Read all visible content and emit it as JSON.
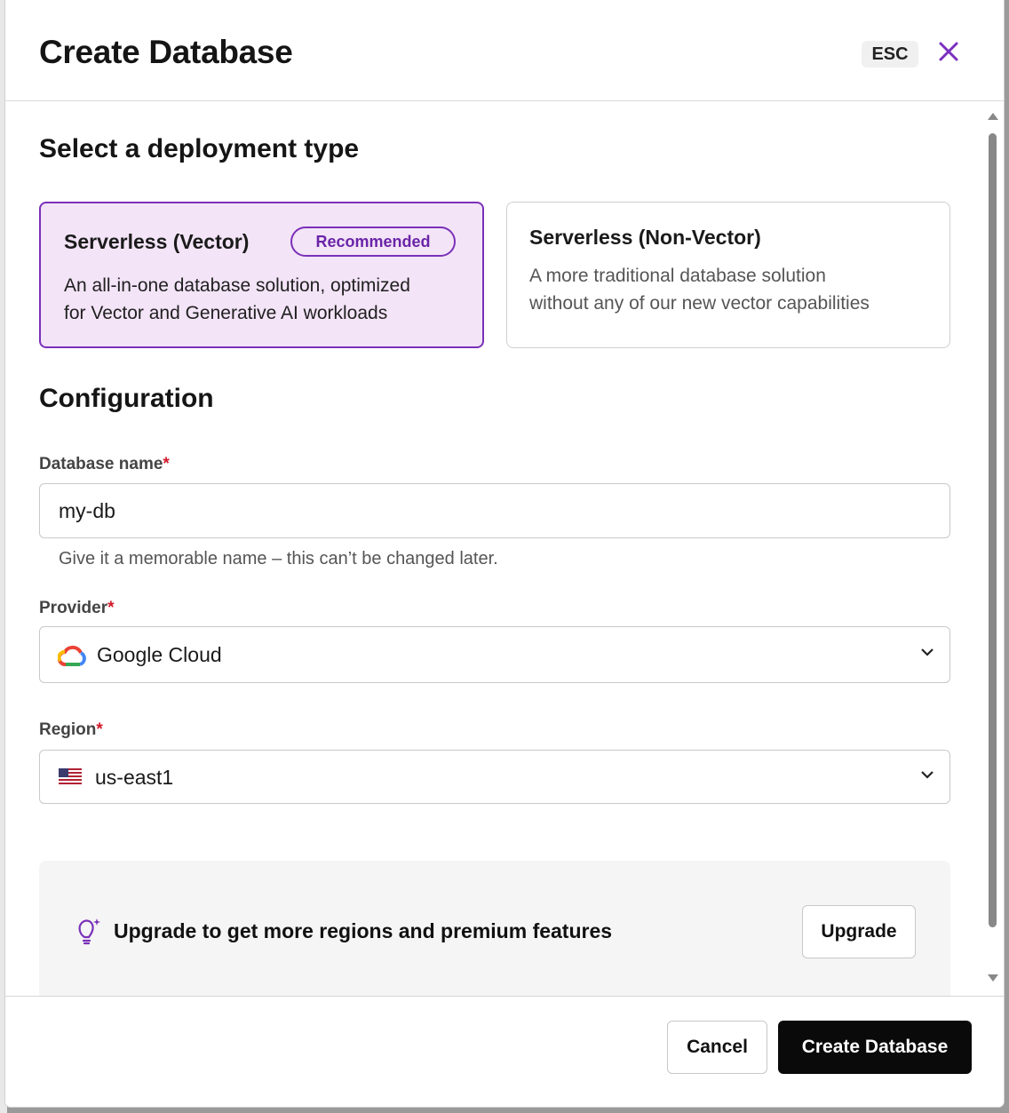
{
  "header": {
    "title": "Create Database",
    "esc_label": "ESC",
    "close_glyph": "✕"
  },
  "deployment": {
    "heading": "Select a deployment type",
    "options": [
      {
        "title": "Serverless (Vector)",
        "badge": "Recommended",
        "desc_line1": "An all-in-one database solution, optimized",
        "desc_line2": "for Vector and Generative AI workloads",
        "selected": true
      },
      {
        "title": "Serverless (Non-Vector)",
        "desc_line1": "A more traditional database solution",
        "desc_line2": "without any of our new vector capabilities",
        "selected": false
      }
    ]
  },
  "configuration": {
    "heading": "Configuration",
    "db_name": {
      "label": "Database name",
      "required_mark": "*",
      "value": "my-db",
      "hint": "Give it a memorable name – this can’t be changed later."
    },
    "provider": {
      "label": "Provider",
      "required_mark": "*",
      "value": "Google Cloud",
      "icon": "google-cloud-icon"
    },
    "region": {
      "label": "Region",
      "required_mark": "*",
      "value": "us-east1",
      "icon": "us-flag-icon"
    }
  },
  "upgrade": {
    "text": "Upgrade to get more regions and premium features",
    "button": "Upgrade",
    "icon": "lightbulb-sparkle-icon"
  },
  "footer": {
    "cancel": "Cancel",
    "create": "Create Database"
  },
  "colors": {
    "accent": "#7a30b8",
    "selected_bg": "#f3e4f7",
    "primary_btn": "#0a0a0a",
    "required": "#d11a2a"
  }
}
